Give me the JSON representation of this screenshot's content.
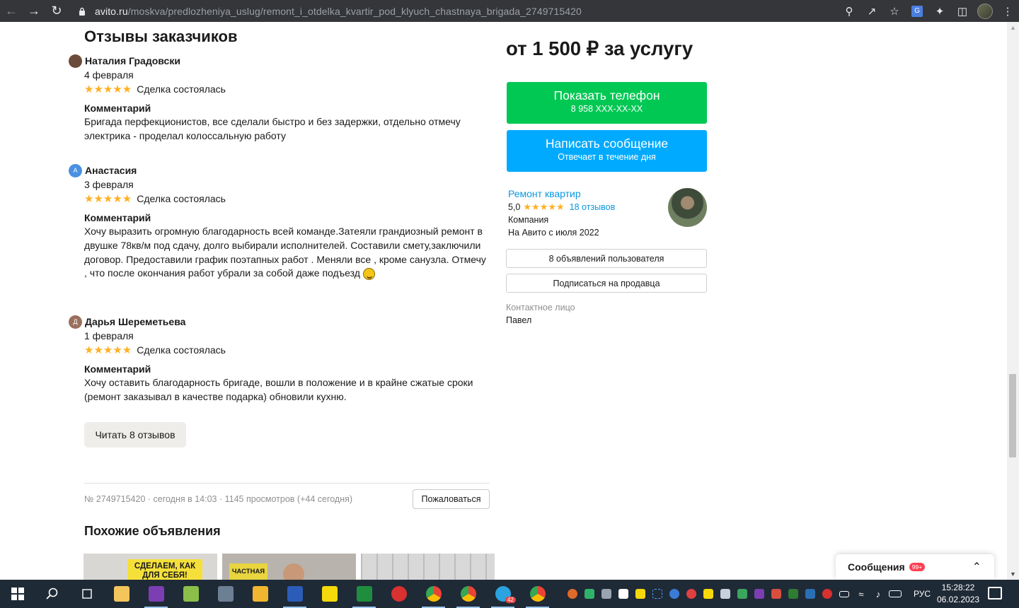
{
  "browser": {
    "url_host": "avito.ru",
    "url_path": "/moskva/predlozheniya_uslug/remont_i_otdelka_kvartir_pod_klyuch_chastnaya_brigada_2749715420"
  },
  "reviews": {
    "title": "Отзывы заказчиков",
    "comment_label": "Комментарий",
    "items": [
      {
        "initial": "",
        "name": "Наталия Градовски",
        "date": "4 февраля",
        "status": "Сделка состоялась",
        "text": "Бригада перфекционистов, все сделали быстро и без задержки, отдельно отмечу электрика - проделал колоссальную работу"
      },
      {
        "initial": "А",
        "name": "Анастасия",
        "date": "3 февраля",
        "status": "Сделка состоялась",
        "text": "Хочу выразить огромную благодарность всей команде.Затеяли грандиозный ремонт в двушке 78кв/м под сдачу, долго выбирали исполнителей. Составили смету,заключили договор. Предоставили график поэтапных работ . Меняли все , кроме санузла. Отмечу , что после окончания работ убрали за собой даже подъезд"
      },
      {
        "initial": "Д",
        "name": "Дарья Шереметьева",
        "date": "1 февраля",
        "status": "Сделка состоялась",
        "text": "Хочу оставить благодарность бригаде, вошли в положение и в крайне сжатые сроки (ремонт заказывал в качестве подарка) обновили кухню."
      }
    ],
    "more_button": "Читать 8 отзывов"
  },
  "listing": {
    "meta": "№ 2749715420 · сегодня в 14:03 · 1145 просмотров (+44 сегодня)",
    "report_button": "Пожаловаться"
  },
  "similar": {
    "title": "Похожие объявления",
    "thumb1_text": "СДЕЛАЕМ, КАК ДЛЯ СЕБЯ!",
    "thumb2_text": "ЧАСТНАЯ"
  },
  "sidebar": {
    "price": "от 1 500 ₽ за услугу",
    "phone_button": "Показать телефон",
    "phone_number": "8 958 XXX-XX-XX",
    "message_button": "Написать сообщение",
    "message_sub": "Отвечает в течение дня",
    "seller_name": "Ремонт квартир",
    "seller_rating": "5,0",
    "seller_reviews": "18 отзывов",
    "seller_type": "Компания",
    "seller_since": "На Авито с июля 2022",
    "listings_button": "8 объявлений пользователя",
    "subscribe_button": "Подписаться на продавца",
    "contact_label": "Контактное лицо",
    "contact_name": "Павел"
  },
  "messages_widget": {
    "label": "Сообщения",
    "badge": "99+"
  },
  "taskbar": {
    "language": "РУС",
    "time": "15:28:22",
    "date": "06.02.2023",
    "telegram_badge": "42"
  },
  "colors": {
    "phone_green": "#00c853",
    "message_blue": "#00aaff",
    "link_blue": "#0a99e0",
    "star": "#ffb021",
    "badge_red": "#ff4053"
  }
}
